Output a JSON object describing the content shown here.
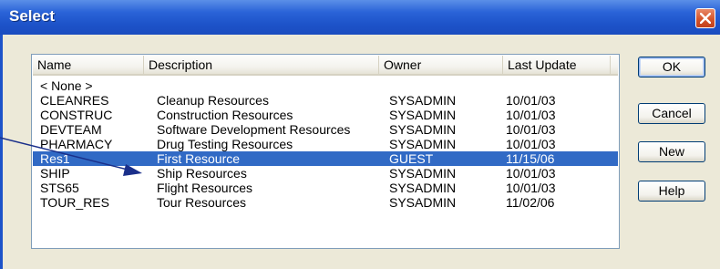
{
  "window": {
    "title": "Select",
    "close_icon": "close-icon",
    "accent_color": "#1d53c9",
    "close_color": "#d5552b"
  },
  "list": {
    "columns": [
      {
        "label": "Name"
      },
      {
        "label": "Description"
      },
      {
        "label": "Owner"
      },
      {
        "label": "Last Update"
      }
    ],
    "rows": [
      {
        "name": "< None >",
        "description": "",
        "owner": "",
        "last_update": ""
      },
      {
        "name": "CLEANRES",
        "description": "Cleanup Resources",
        "owner": "SYSADMIN",
        "last_update": "10/01/03"
      },
      {
        "name": "CONSTRUC",
        "description": "Construction Resources",
        "owner": "SYSADMIN",
        "last_update": "10/01/03"
      },
      {
        "name": "DEVTEAM",
        "description": "Software Development Resources",
        "owner": "SYSADMIN",
        "last_update": "10/01/03"
      },
      {
        "name": "PHARMACY",
        "description": "Drug Testing Resources",
        "owner": "SYSADMIN",
        "last_update": "10/01/03"
      },
      {
        "name": "Res1",
        "description": "First Resource",
        "owner": "GUEST",
        "last_update": "11/15/06"
      },
      {
        "name": "SHIP",
        "description": "Ship Resources",
        "owner": "SYSADMIN",
        "last_update": "10/01/03"
      },
      {
        "name": "STS65",
        "description": "Flight Resources",
        "owner": "SYSADMIN",
        "last_update": "10/01/03"
      },
      {
        "name": "TOUR_RES",
        "description": "Tour Resources",
        "owner": "SYSADMIN",
        "last_update": "11/02/06"
      }
    ],
    "selected_index": 5,
    "selection_color": "#316ac5"
  },
  "buttons": {
    "ok": "OK",
    "cancel": "Cancel",
    "new": "New",
    "help": "Help"
  },
  "annotation": {
    "arrow_icon": "pointer-arrow",
    "arrow_color": "#1a2f8a"
  }
}
